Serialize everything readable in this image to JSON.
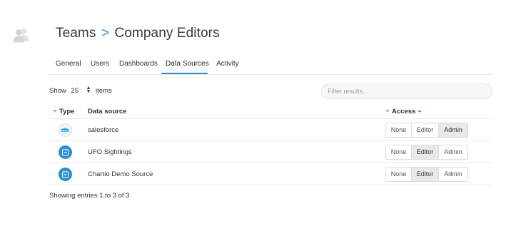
{
  "header": {
    "avatar_icon": "users-group-icon",
    "breadcrumb_parent": "Teams",
    "breadcrumb_separator": ">",
    "breadcrumb_current": "Company Editors"
  },
  "tabs": [
    {
      "label": "General"
    },
    {
      "label": "Users"
    },
    {
      "label": "Dashboards"
    },
    {
      "label": "Data Sources",
      "active": true
    },
    {
      "label": "Activity"
    }
  ],
  "controls": {
    "show_label": "Show",
    "page_size": "25",
    "items_label": "items",
    "filter_placeholder": "Filter results..."
  },
  "table": {
    "columns": {
      "type": "Type",
      "data_source": "Data source",
      "access": "Access"
    },
    "access_options": [
      "None",
      "Editor",
      "Admin"
    ],
    "rows": [
      {
        "icon": "salesforce-cloud-icon",
        "name": "salesforce",
        "access": "Admin"
      },
      {
        "icon": "database-icon",
        "name": "UFO Sightings",
        "access": "Editor"
      },
      {
        "icon": "database-icon",
        "name": "Chartio Demo Source",
        "access": "Editor"
      }
    ]
  },
  "footer": {
    "summary": "Showing entries 1 to 3 of 3"
  },
  "colors": {
    "accent": "#2a8fd0",
    "icon_blue": "#2a8fd0",
    "selected_bg": "#e9e9e9"
  }
}
